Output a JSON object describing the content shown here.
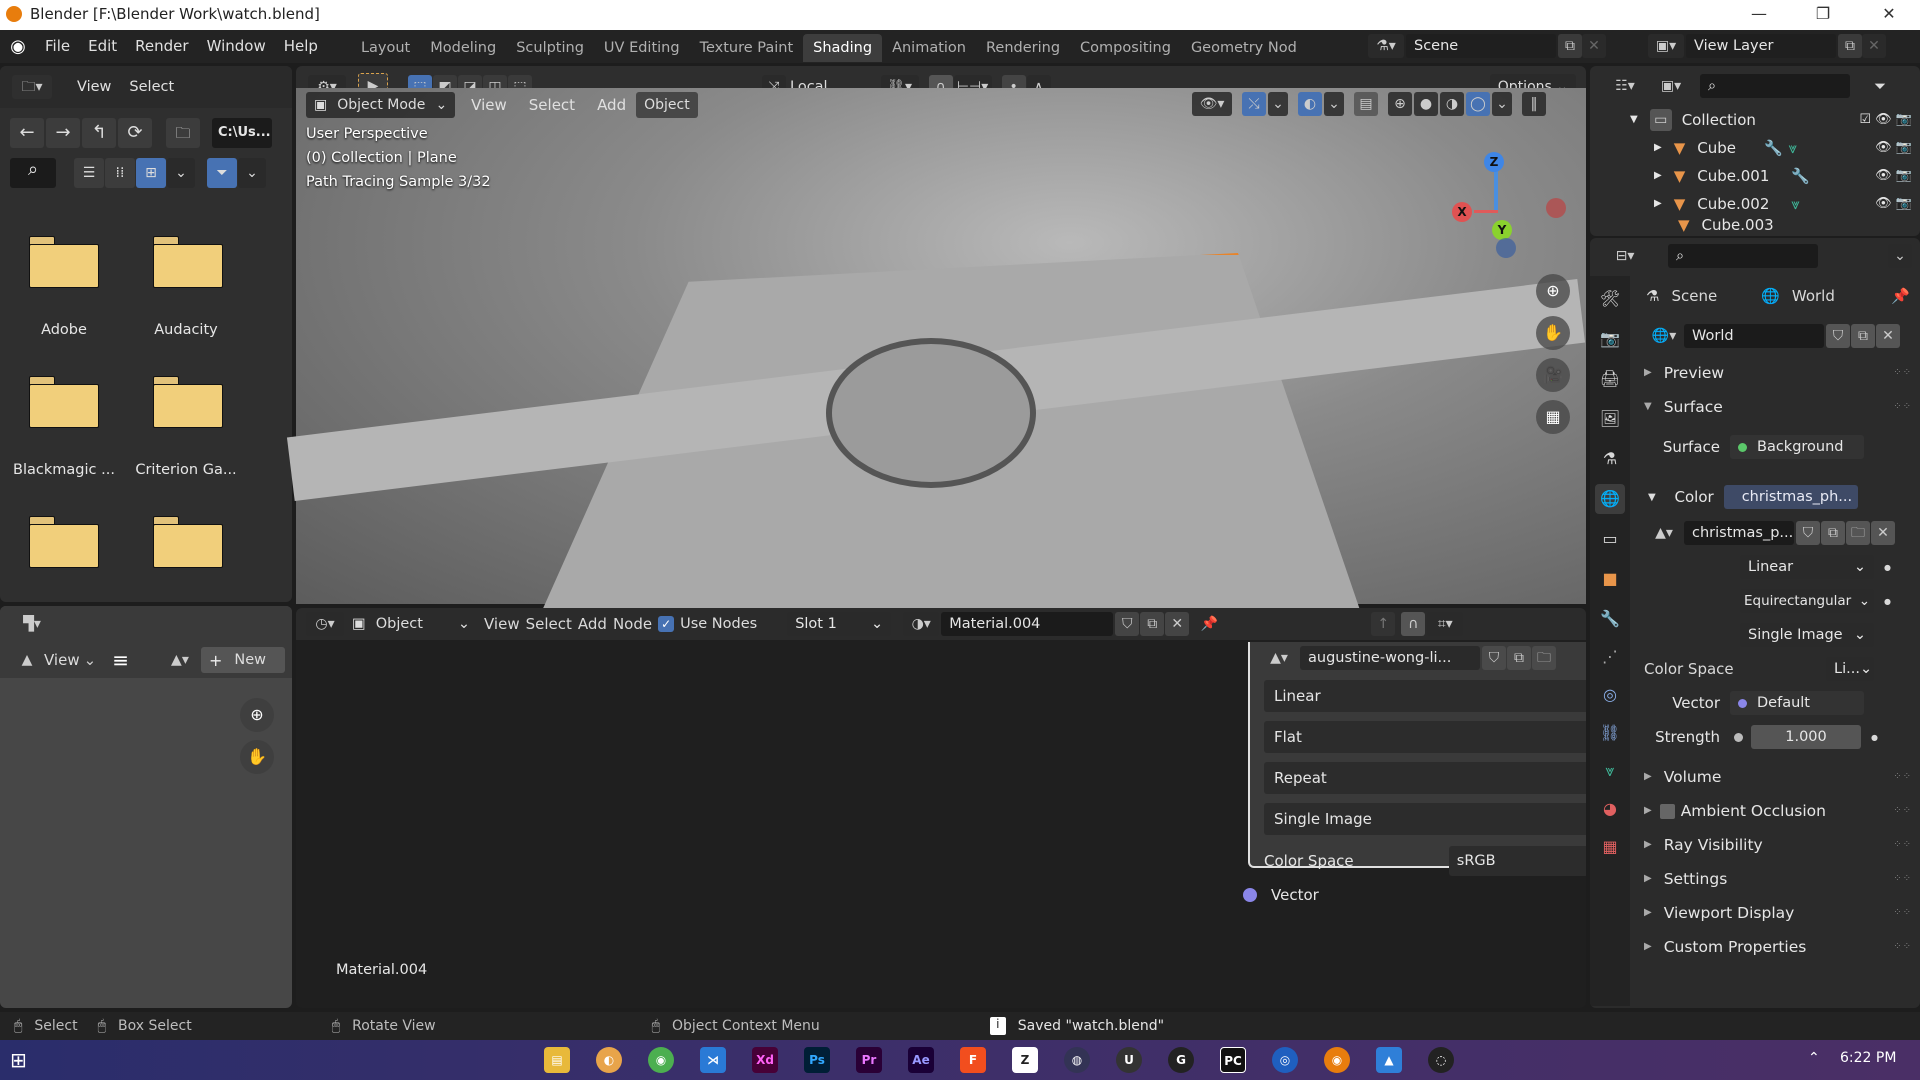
{
  "window": {
    "title": "Blender [F:\\Blender Work\\watch.blend]",
    "controls": {
      "minimize": "—",
      "restore": "❐",
      "close": "✕"
    }
  },
  "menubar": {
    "items": [
      "File",
      "Edit",
      "Render",
      "Window",
      "Help"
    ],
    "workspaces": [
      {
        "label": "Layout",
        "active": false
      },
      {
        "label": "Modeling",
        "active": false
      },
      {
        "label": "Sculpting",
        "active": false
      },
      {
        "label": "UV Editing",
        "active": false
      },
      {
        "label": "Texture Paint",
        "active": false
      },
      {
        "label": "Shading",
        "active": true
      },
      {
        "label": "Animation",
        "active": false
      },
      {
        "label": "Rendering",
        "active": false
      },
      {
        "label": "Compositing",
        "active": false
      },
      {
        "label": "Geometry Nod",
        "active": false
      }
    ],
    "scene": "Scene",
    "view_layer": "View Layer"
  },
  "file_browser": {
    "header": {
      "view": "View",
      "select": "Select"
    },
    "path": "C:\\Us...",
    "folders": [
      "Adobe",
      "Audacity",
      "Blackmagic ...",
      "Criterion Ga...",
      "",
      ""
    ]
  },
  "image_editor": {
    "view": "View",
    "new_button": "New"
  },
  "viewport": {
    "toolbar": {
      "orientation": "Local",
      "options": "Options"
    },
    "header": {
      "mode": "Object Mode",
      "view": "View",
      "select": "Select",
      "add": "Add",
      "object": "Object"
    },
    "overlay": {
      "line1": "User Perspective",
      "line2": "(0) Collection | Plane",
      "line3": "Path Tracing Sample 3/32"
    },
    "gizmo": {
      "x": "X",
      "y": "Y",
      "z": "Z"
    }
  },
  "node_editor": {
    "header": {
      "mode": "Object",
      "view": "View",
      "select": "Select",
      "add": "Add",
      "node": "Node",
      "use_nodes": "Use Nodes",
      "use_nodes_checked": true,
      "slot": "Slot 1",
      "material": "Material.004"
    },
    "material_label": "Material.004",
    "image_node": {
      "image": "augustine-wong-li...",
      "interpolation": "Linear",
      "projection": "Flat",
      "extension": "Repeat",
      "source": "Single Image",
      "color_space_label": "Color Space",
      "color_space": "sRGB",
      "vector_socket": "Vector"
    }
  },
  "outliner": {
    "items": [
      {
        "name": "Collection",
        "type": "collection"
      },
      {
        "name": "Cube",
        "type": "mesh"
      },
      {
        "name": "Cube.001",
        "type": "mesh"
      },
      {
        "name": "Cube.002",
        "type": "mesh"
      },
      {
        "name": "Cube.003",
        "type": "mesh"
      }
    ]
  },
  "properties": {
    "breadcrumb": {
      "scene": "Scene",
      "world": "World"
    },
    "world_name": "World",
    "sections": {
      "preview": "Preview",
      "surface": "Surface"
    },
    "surface": {
      "surface_label": "Surface",
      "surface_value": "Background",
      "color_label": "Color",
      "color_value": "christmas_ph...",
      "image_name": "christmas_p...",
      "interpolation": "Linear",
      "projection": "Equirectangular",
      "source": "Single Image",
      "color_space_label": "Color Space",
      "color_space": "Li...",
      "vector_label": "Vector",
      "vector_value": "Default",
      "strength_label": "Strength",
      "strength_value": "1.000"
    },
    "collapsed_sections": [
      "Volume",
      "Ambient Occlusion",
      "Ray Visibility",
      "Settings",
      "Viewport Display",
      "Custom Properties"
    ]
  },
  "statusbar": {
    "select": "Select",
    "box_select": "Box Select",
    "rotate_view": "Rotate View",
    "context_menu": "Object Context Menu",
    "message": "Saved \"watch.blend\""
  },
  "taskbar": {
    "apps": [
      "File Explorer",
      "Firefox",
      "Chrome",
      "VS Code",
      "Xd",
      "Ps",
      "Pr",
      "Ae",
      "Figma",
      "ZBrush",
      "DaVinci Resolve",
      "Unreal",
      "Logitech G",
      "PyCharm",
      "Cinema 4D",
      "Blender",
      "Photos",
      "OBS"
    ],
    "clock": "6:22 PM"
  },
  "colors": {
    "accent": "#4772b3",
    "active_orange": "#e87d0d",
    "folder": "#f1cf7b"
  }
}
